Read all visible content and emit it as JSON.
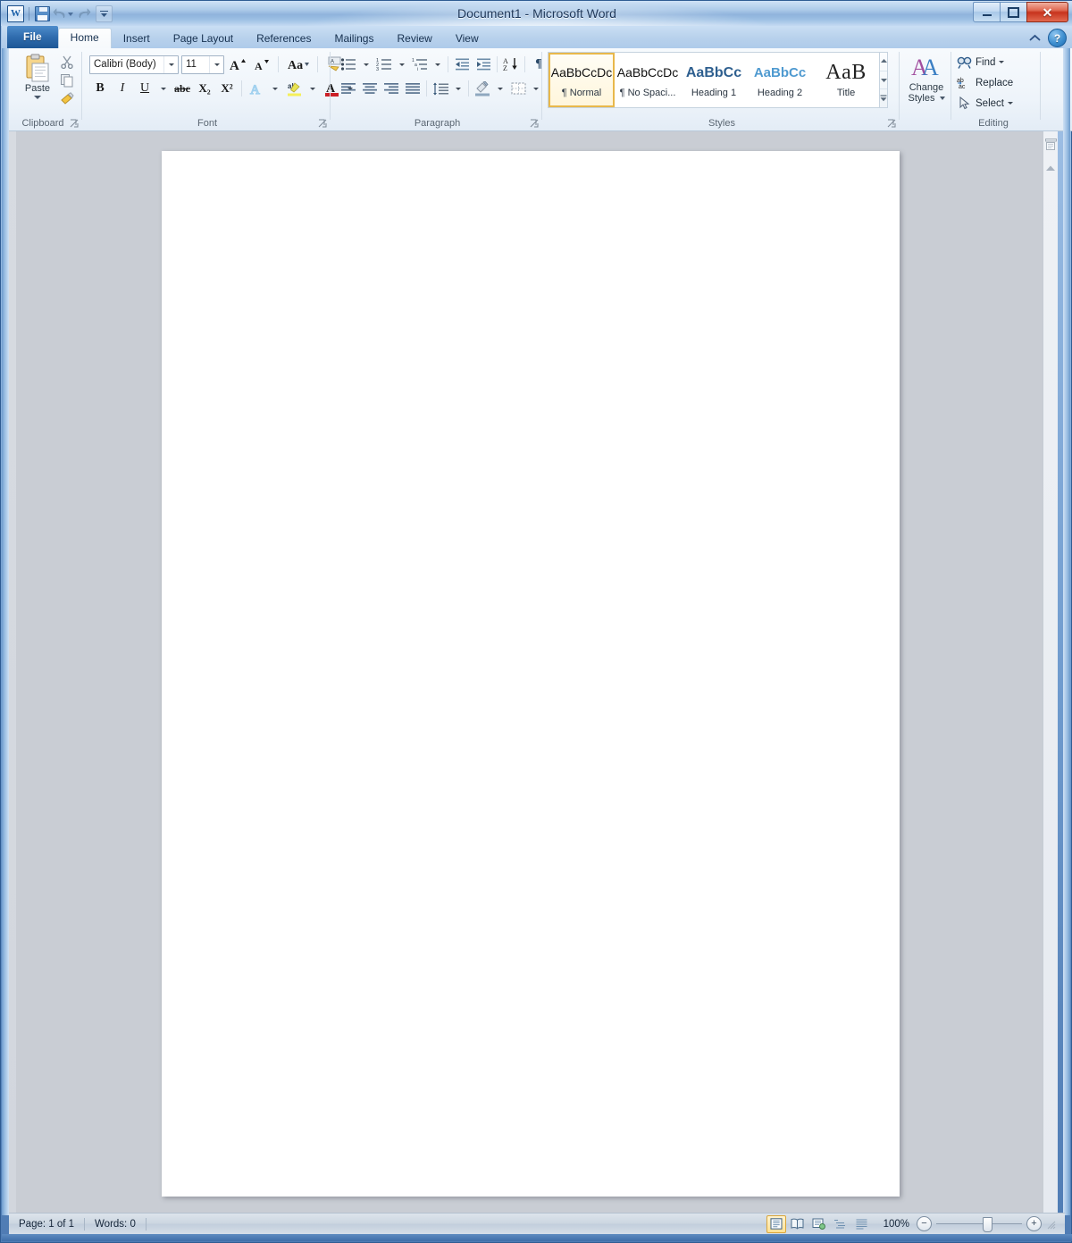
{
  "window": {
    "title": "Document1 - Microsoft Word",
    "controls": {
      "minimize": "Minimize",
      "maximize": "Maximize",
      "close": "Close"
    }
  },
  "quick_access": {
    "app_logo": "W",
    "items": [
      {
        "name": "save",
        "label": "Save",
        "icon": "save-icon"
      },
      {
        "name": "undo",
        "label": "Undo",
        "icon": "undo-icon"
      },
      {
        "name": "redo",
        "label": "Redo",
        "icon": "redo-icon"
      },
      {
        "name": "customize",
        "label": "Customize Quick Access Toolbar",
        "icon": "chevron-down-icon"
      }
    ]
  },
  "tabs": [
    {
      "label": "File",
      "active": false,
      "file": true
    },
    {
      "label": "Home",
      "active": true
    },
    {
      "label": "Insert",
      "active": false
    },
    {
      "label": "Page Layout",
      "active": false
    },
    {
      "label": "References",
      "active": false
    },
    {
      "label": "Mailings",
      "active": false
    },
    {
      "label": "Review",
      "active": false
    },
    {
      "label": "View",
      "active": false
    }
  ],
  "ribbon_right": {
    "minimize_ribbon": "Minimize the Ribbon",
    "help": "?"
  },
  "groups": {
    "clipboard": {
      "label": "Clipboard",
      "paste_label": "Paste",
      "cut_label": "Cut",
      "copy_label": "Copy",
      "format_painter_label": "Format Painter",
      "dialog_launcher": "Clipboard dialog box launcher"
    },
    "font": {
      "label": "Font",
      "font_name": "Calibri (Body)",
      "font_size": "11",
      "grow_font": "Grow Font",
      "shrink_font": "Shrink Font",
      "change_case": "Aa",
      "clear_formatting": "Clear Formatting",
      "bold": "B",
      "italic": "I",
      "underline": "U",
      "strikethrough": "abc",
      "subscript": "X₂",
      "superscript": "X²",
      "text_effects": "Text Effects",
      "highlight": "Text Highlight Color",
      "font_color": "Font Color",
      "dialog_launcher": "Font dialog box launcher"
    },
    "paragraph": {
      "label": "Paragraph",
      "bullets": "Bullets",
      "numbering": "Numbering",
      "multilevel_list": "Multilevel List",
      "decrease_indent": "Decrease Indent",
      "increase_indent": "Increase Indent",
      "sort": "Sort",
      "show_marks": "¶",
      "align_left": "Align Text Left",
      "center": "Center",
      "align_right": "Align Text Right",
      "justify": "Justify",
      "line_spacing": "Line and Paragraph Spacing",
      "shading": "Shading",
      "borders": "Borders",
      "dialog_launcher": "Paragraph dialog box launcher"
    },
    "styles": {
      "label": "Styles",
      "items": [
        {
          "preview": "AaBbCcDc",
          "name": "¶ Normal",
          "selected": true
        },
        {
          "preview": "AaBbCcDc",
          "name": "¶ No Spaci...",
          "selected": false
        },
        {
          "preview": "AaBbCс",
          "name": "Heading 1",
          "selected": false
        },
        {
          "preview": "AaBbCc",
          "name": "Heading 2",
          "selected": false
        },
        {
          "preview": "AaB",
          "name": "Title",
          "selected": false
        }
      ],
      "scroll_up": "Scroll up",
      "scroll_down": "Scroll down",
      "more": "More",
      "dialog_launcher": "Styles dialog box launcher"
    },
    "change_styles": {
      "label_line1": "Change",
      "label_line2": "Styles"
    },
    "editing": {
      "label": "Editing",
      "find": "Find",
      "replace": "Replace",
      "select": "Select"
    }
  },
  "document": {
    "page_count_visible": 1,
    "content": ""
  },
  "status_bar": {
    "page": "Page: 1 of 1",
    "words": "Words: 0",
    "views": [
      {
        "name": "print-layout",
        "label": "Print Layout",
        "selected": true
      },
      {
        "name": "full-screen-reading",
        "label": "Full Screen Reading",
        "selected": false
      },
      {
        "name": "web-layout",
        "label": "Web Layout",
        "selected": false
      },
      {
        "name": "outline",
        "label": "Outline",
        "selected": false
      },
      {
        "name": "draft",
        "label": "Draft",
        "selected": false
      }
    ],
    "zoom": "100%",
    "zoom_out": "−",
    "zoom_in": "+"
  },
  "colors": {
    "accent": "#1d5796",
    "selection_gold": "#ffd978",
    "heading1": "#2e5f8f",
    "heading2": "#4f9ad0",
    "close_red": "#c7341d",
    "page_bg": "#ffffff",
    "canvas_bg": "#c9cdd4"
  }
}
